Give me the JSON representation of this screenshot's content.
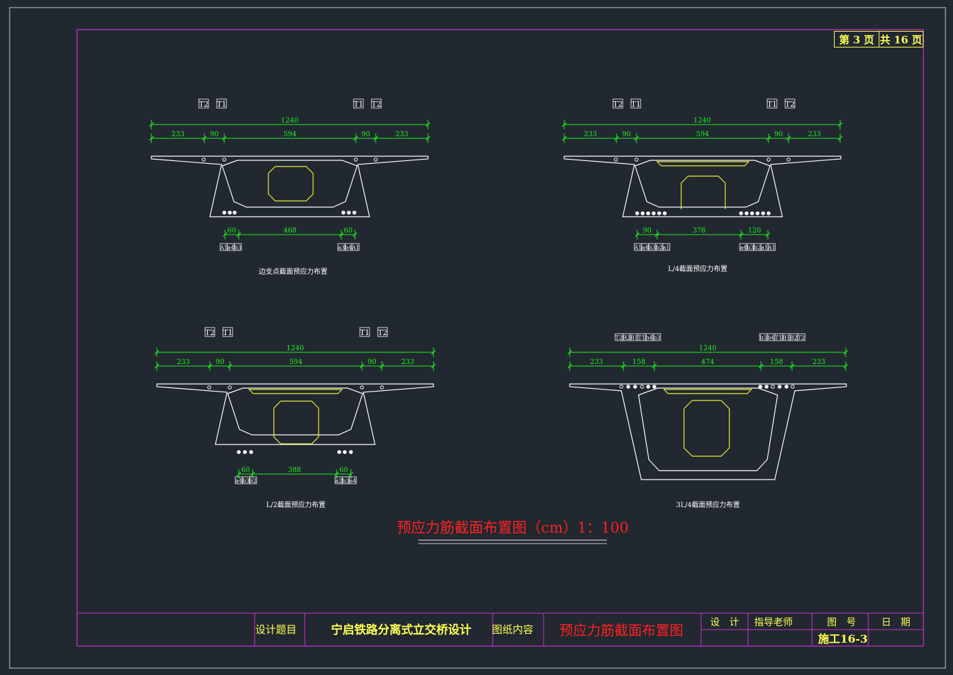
{
  "page": {
    "current_label": "第 3 页",
    "total_label": "共 16 页"
  },
  "drawing_title": "预应力筋截面布置图（cm）1：100",
  "title_block": {
    "design_topic_label": "设计题目",
    "design_topic": "宁启铁路分离式立交桥设计",
    "content_label": "图纸内容",
    "content": "预应力筋截面布置图",
    "design_label": "设　计",
    "advisor_label": "指导老师",
    "drawing_no_label": "图　号",
    "date_label": "日　期",
    "drawing_no": "施工16-3"
  },
  "colors": {
    "background": "#212830",
    "border": "#cc33cc",
    "section": "#ffffff",
    "dimension": "#22ee22",
    "duct": "#eeee33",
    "title": "#ff2222",
    "titleblock": "#ffff55",
    "frame": "#c8c8c8"
  },
  "sections": [
    {
      "caption": "边支点截面预应力布置",
      "top_labels_left": [
        "T2",
        "T1"
      ],
      "top_labels_right": [
        "T1",
        "T2"
      ],
      "overall_dim": "1240",
      "top_dims": [
        "233",
        "90",
        "594",
        "90",
        "233"
      ],
      "bottom_dims": [
        "60",
        "468",
        "60"
      ],
      "bottom_labels_left": [
        "A1",
        "a4",
        "b3"
      ],
      "bottom_labels_right": [
        "a3",
        "b4",
        "A1"
      ]
    },
    {
      "caption": "L/4截面预应力布置",
      "top_labels_left": [
        "T2",
        "T1"
      ],
      "top_labels_right": [
        "T1",
        "T2"
      ],
      "overall_dim": "1240",
      "top_dims": [
        "233",
        "90",
        "594",
        "90",
        "233"
      ],
      "bottom_dims": [
        "90",
        "378",
        "120"
      ],
      "bottom_labels_left": [
        "A1",
        "a4",
        "b3",
        "b2",
        "a1"
      ],
      "bottom_labels_right": [
        "a4",
        "b3",
        "b2",
        "a1",
        "A1"
      ]
    },
    {
      "caption": "L/2截面预应力布置",
      "top_labels_left": [
        "T2",
        "T1"
      ],
      "top_labels_right": [
        "T1",
        "T2"
      ],
      "overall_dim": "1240",
      "top_dims": [
        "233",
        "90",
        "594",
        "90",
        "233"
      ],
      "bottom_dims": [
        "60",
        "388",
        "60"
      ],
      "bottom_labels_left": [
        "a4",
        "b3",
        "b2"
      ],
      "bottom_labels_right": [
        "a2",
        "b3",
        "a4"
      ]
    },
    {
      "caption": "3L/4截面预应力布置",
      "top_labels_left": [
        "T2",
        "B2",
        "B1",
        "T1",
        "b4",
        "b3"
      ],
      "top_labels_right": [
        "b3",
        "b4",
        "T1",
        "B1",
        "B2",
        "T2"
      ],
      "overall_dim": "1240",
      "top_dims": [
        "233",
        "158",
        "474",
        "158",
        "233"
      ],
      "bottom_dims": [],
      "bottom_labels_left": [],
      "bottom_labels_right": []
    }
  ]
}
